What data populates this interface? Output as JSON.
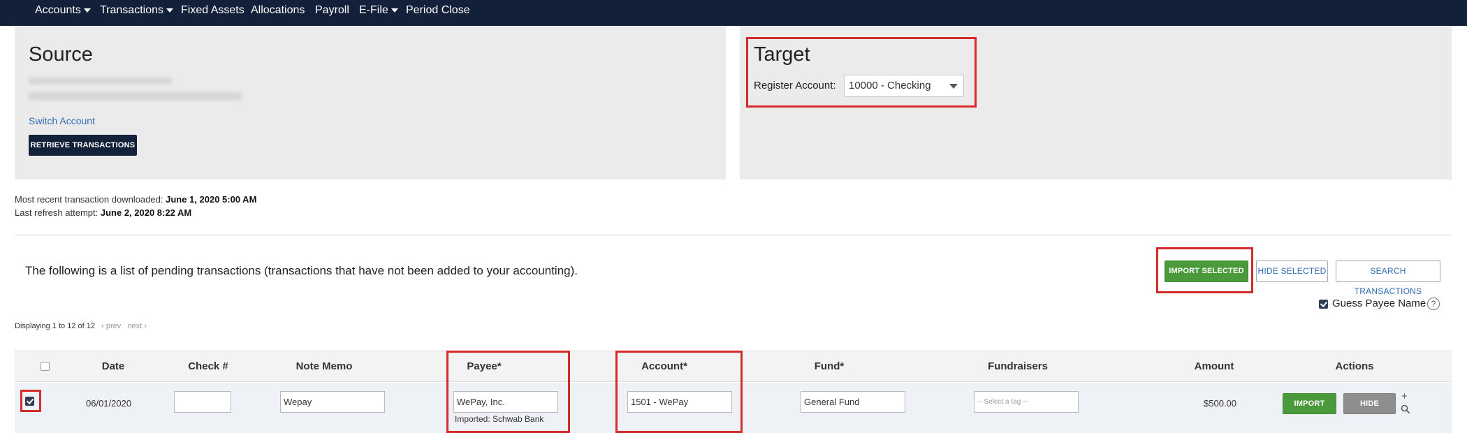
{
  "nav": {
    "items": [
      {
        "label": "Accounts",
        "dropdown": true
      },
      {
        "label": "Transactions",
        "dropdown": true
      },
      {
        "label": "Fixed Assets",
        "dropdown": false
      },
      {
        "label": "Allocations",
        "dropdown": false
      },
      {
        "label": "Payroll",
        "dropdown": false
      },
      {
        "label": "E-File",
        "dropdown": true
      },
      {
        "label": "Period Close",
        "dropdown": false
      }
    ]
  },
  "source": {
    "title": "Source",
    "switch_account": "Switch Account",
    "retrieve_button": "RETRIEVE TRANSACTIONS"
  },
  "target": {
    "title": "Target",
    "register_label": "Register Account:",
    "register_value": "10000 - Checking"
  },
  "status": {
    "recent_label": "Most recent transaction downloaded:",
    "recent_value": "June 1, 2020 5:00 AM",
    "refresh_label": "Last refresh attempt:",
    "refresh_value": "June 2, 2020 8:22 AM"
  },
  "pending": {
    "text": "The following is a list of pending transactions (transactions that have not been added to your accounting).",
    "import_selected": "IMPORT SELECTED",
    "hide_selected": "HIDE SELECTED",
    "search_transactions": "SEARCH TRANSACTIONS",
    "guess_payee": "Guess Payee Name",
    "guess_payee_checked": true,
    "help": "?"
  },
  "paging": {
    "displaying": "Displaying 1 to 12 of 12",
    "prev": "‹ prev",
    "next": "next ›"
  },
  "table": {
    "headers": [
      "Date",
      "Check #",
      "Note Memo",
      "Payee*",
      "Account*",
      "Fund*",
      "Fundraisers",
      "Amount",
      "Actions"
    ],
    "row": {
      "checked": true,
      "date": "06/01/2020",
      "check": "",
      "memo": "Wepay",
      "payee": "WePay, Inc.",
      "payee_note": "Imported: Schwab Bank",
      "account": "1501 - WePay",
      "fund": "General Fund",
      "fundraisers_placeholder": "-- Select a tag --",
      "amount": "$500.00",
      "import_button": "IMPORT",
      "hide_button": "HIDE",
      "plus": "+"
    }
  },
  "colors": {
    "nav_bg": "#12203a",
    "accent_green": "#4a9a3c",
    "highlight_red": "#d62b2b",
    "link_blue": "#2f6db3"
  }
}
